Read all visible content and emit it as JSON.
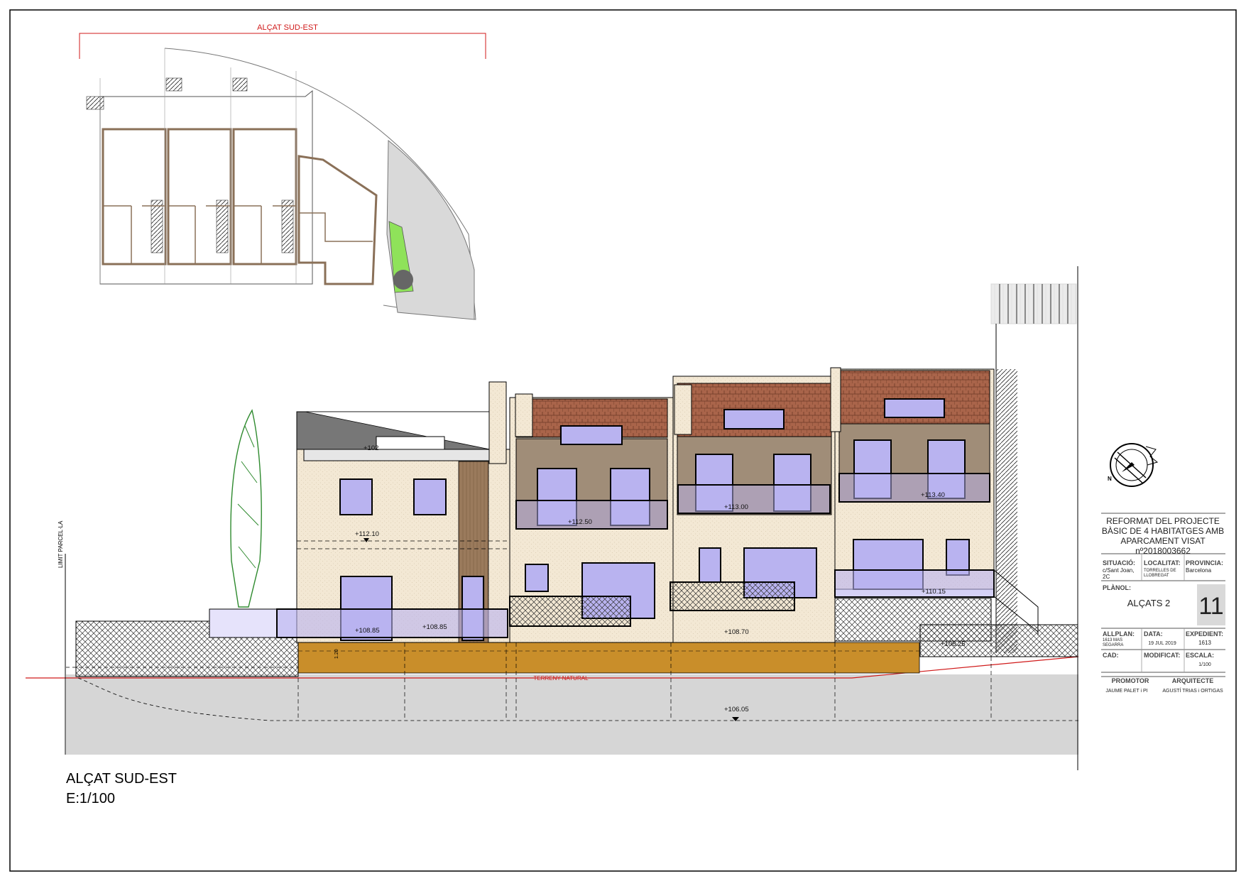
{
  "sheet": {
    "plan_label": "ALÇAT SUD-EST",
    "elevation_title": "ALÇAT SUD-EST",
    "elevation_scale": "E:1/100",
    "boundary_label": "LIMIT PARCEL·LA",
    "ground_label": "TERRENY NATURAL",
    "dimension_label": "1.20"
  },
  "levels": [
    "+112.10",
    "+112.50",
    "+113.00",
    "+113.40",
    "+108.85",
    "+108.85",
    "+108.70",
    "+110.15",
    "+108.25",
    "+106.05",
    "+102"
  ],
  "title_block": {
    "project_line1": "REFORMAT DEL PROJECTE",
    "project_line2": "BÀSIC DE 4 HABITATGES AMB",
    "project_line3": "APARCAMENT VISAT",
    "project_line4": "nº2018003662",
    "situacio_label": "SITUACIÓ:",
    "situacio_value1": "c/Sant Joan,",
    "situacio_value2": "2C",
    "localitat_label": "LOCALITAT:",
    "localitat_value1": "TORRELLES DE",
    "localitat_value2": "LLOBREGAT",
    "provincia_label": "PROVINCIA:",
    "provincia_value": "Barcelona",
    "planol_label": "PLÀNOL:",
    "planol_value": "ALÇATS 2",
    "sheet_number": "11",
    "allplan_label": "ALLPLAN:",
    "allplan_value1": "1613 MAS",
    "allplan_value2": "SEGARRA",
    "data_label": "DATA:",
    "data_value": "19 JUL 2019",
    "expedient_label": "EXPEDIENT:",
    "expedient_value": "1613",
    "cad_label": "CAD:",
    "modificat_label": "MODIFICAT:",
    "escala_label": "ESCALA:",
    "escala_value": "1/100",
    "promotor_label": "PROMOTOR",
    "promotor_value": "JAUME PALET i PI",
    "arquitecte_label": "ARQUITECTE",
    "arquitecte_value": "AGUSTÍ TRIAS i ORTIGAS"
  },
  "colors": {
    "facade": "#f3e8d4",
    "roof_tile": "#a9644a",
    "glass": "#b9b3f0",
    "foundation": "#c98e2a",
    "ground": "#d6d6d6",
    "plan_garden": "#8fe25a",
    "plan_gray": "#d9d9d9",
    "red_line": "#d01a1a",
    "wood": "#9a7a5c"
  }
}
